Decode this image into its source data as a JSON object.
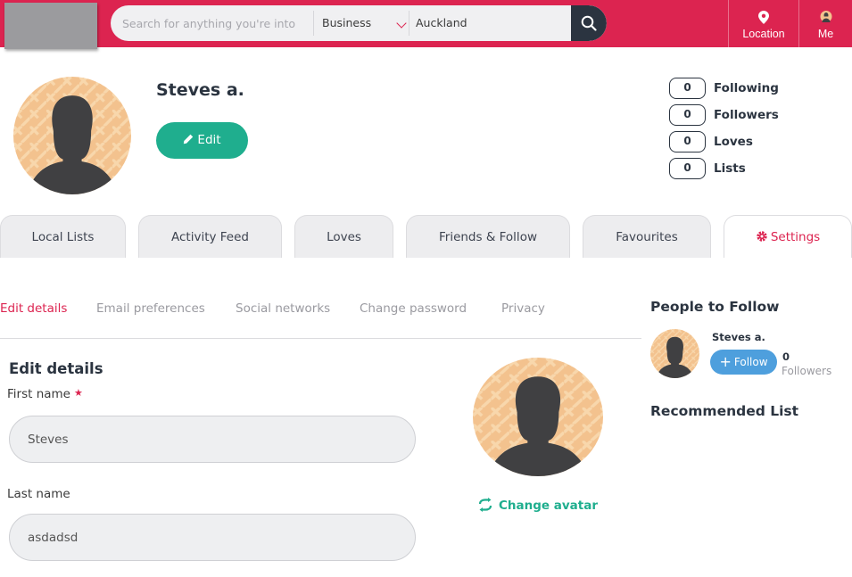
{
  "header": {
    "search_placeholder": "Search for anything you're into",
    "category": "Business",
    "location_value": "Auckland",
    "nav": {
      "location": "Location",
      "me": "Me"
    }
  },
  "profile": {
    "name": "Steves a.",
    "edit_label": "Edit",
    "stats": [
      {
        "count": "0",
        "label": "Following"
      },
      {
        "count": "0",
        "label": "Followers"
      },
      {
        "count": "0",
        "label": "Loves"
      },
      {
        "count": "0",
        "label": "Lists"
      }
    ]
  },
  "tabs": [
    "Local Lists",
    "Activity Feed",
    "Loves",
    "Friends & Follow",
    "Favourites",
    "Settings"
  ],
  "active_tab": "Settings",
  "settings_nav": [
    "Edit details",
    "Email preferences",
    "Social networks",
    "Change password",
    "Privacy"
  ],
  "form": {
    "title": "Edit details",
    "first_name_label": "First name",
    "first_name_value": "Steves",
    "last_name_label": "Last name",
    "last_name_value": "asdadsd",
    "change_avatar": "Change avatar"
  },
  "sidebar": {
    "people_heading": "People to Follow",
    "suggestion": {
      "name": "Steves a.",
      "follow_label": "Follow",
      "count": "0",
      "count_label": "Followers"
    },
    "recommended_heading": "Recommended List"
  },
  "colors": {
    "brand": "#dc2450",
    "accent_green": "#1fae8e",
    "follow_blue": "#4e9fdd",
    "dark": "#2b3440"
  }
}
